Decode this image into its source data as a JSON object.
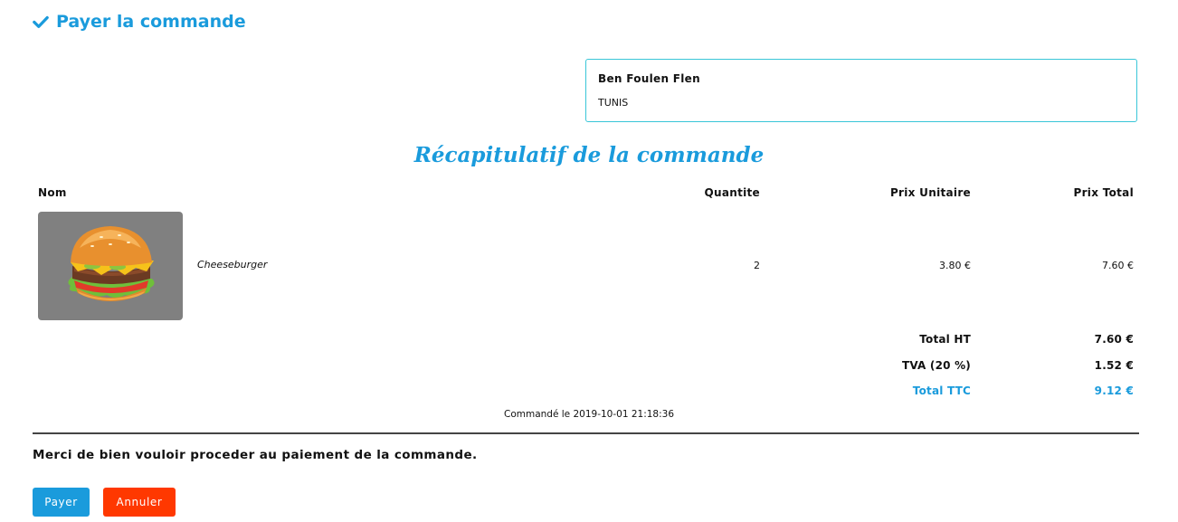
{
  "header": {
    "title": "Payer la commande",
    "icon": "check-icon"
  },
  "address": {
    "name": "Ben Foulen Flen",
    "city": "TUNIS"
  },
  "recap": {
    "title": "Récapitulatif de la commande",
    "columns": {
      "nom": "Nom",
      "quantite": "Quantite",
      "prix_unitaire": "Prix Unitaire",
      "prix_total": "Prix Total"
    },
    "items": [
      {
        "name": "Cheeseburger",
        "quantity": "2",
        "unit_price": "3.80 €",
        "total_price": "7.60 €",
        "image": "cheeseburger-image"
      }
    ],
    "totals": {
      "ht_label": "Total HT",
      "ht_value": "7.60 €",
      "tva_label": "TVA (20 %)",
      "tva_value": "1.52 €",
      "ttc_label": "Total TTC",
      "ttc_value": "9.12 €"
    },
    "ordered_at": "Commandé le 2019-10-01 21:18:36"
  },
  "message": "Merci de bien vouloir proceder au paiement de la commande.",
  "buttons": {
    "pay": "Payer",
    "cancel": "Annuler"
  },
  "colors": {
    "accent": "#1a9bdc",
    "danger": "#ff3800",
    "box_border": "#39c6d8"
  }
}
